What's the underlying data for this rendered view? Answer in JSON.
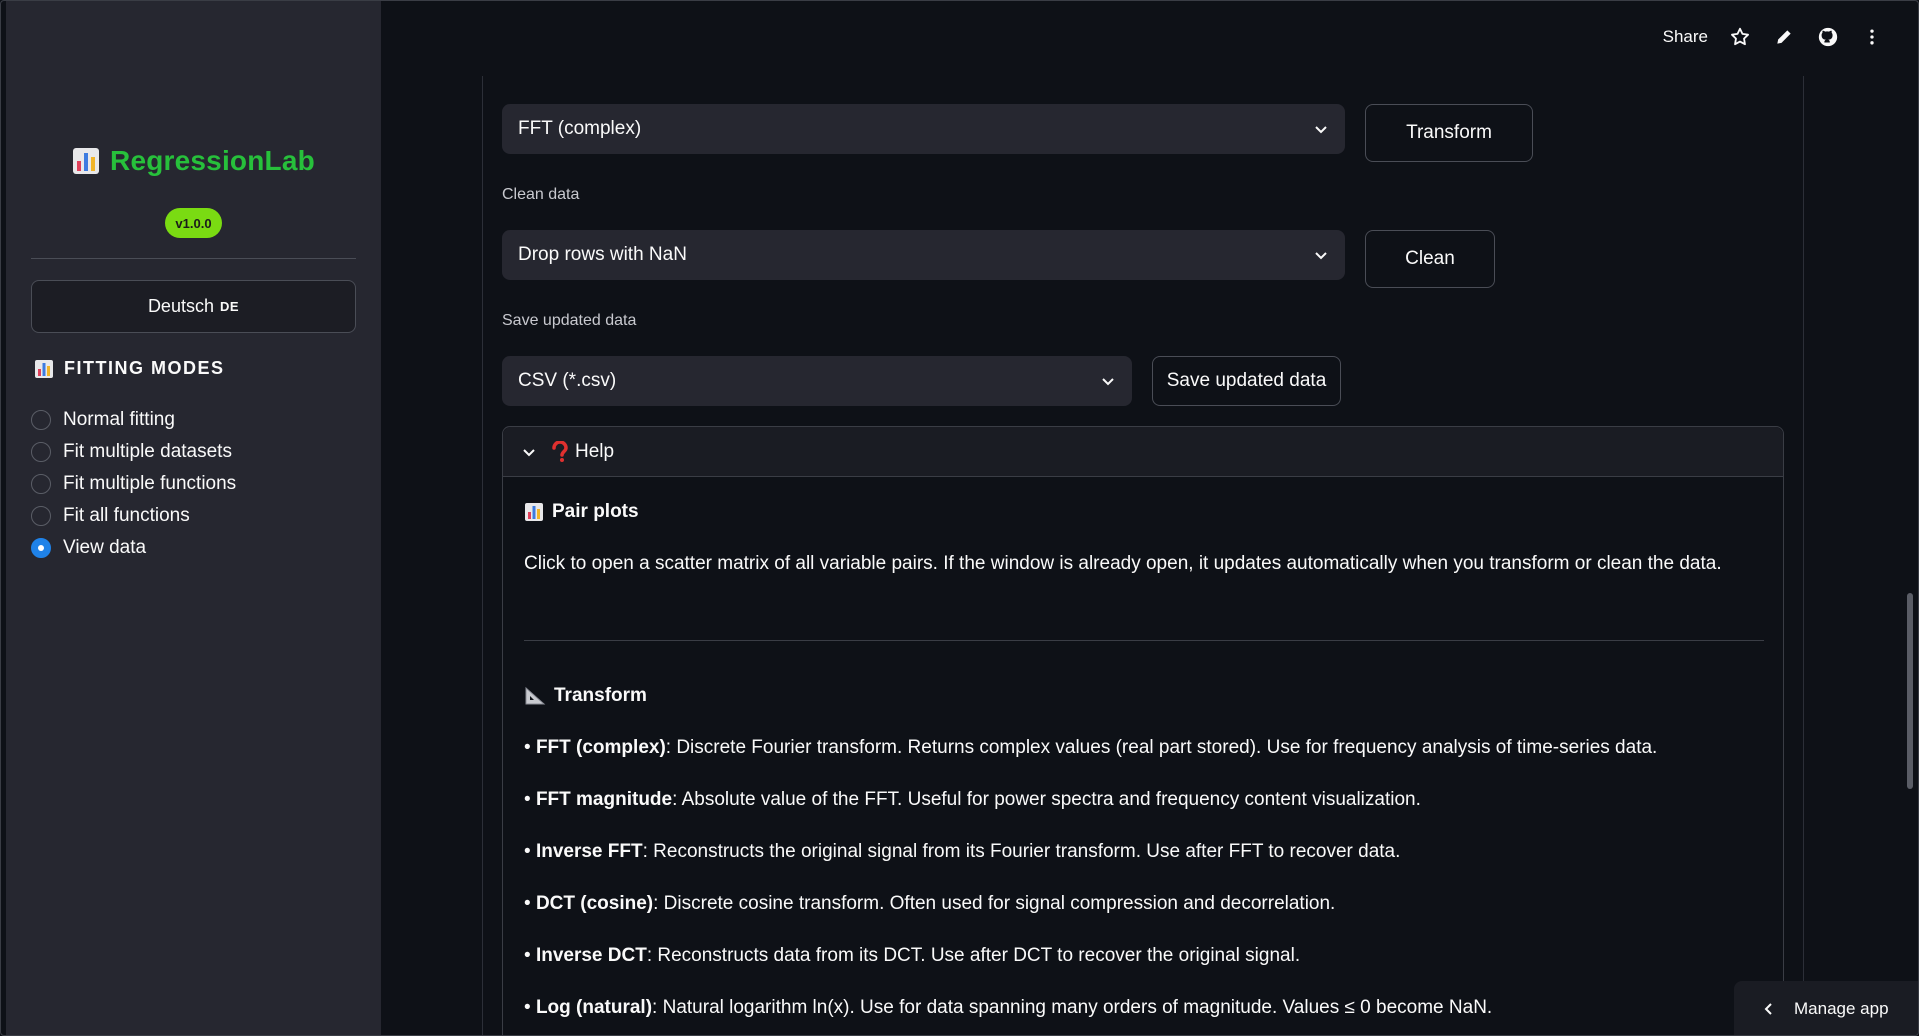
{
  "toolbar": {
    "share_label": "Share",
    "icons": [
      "star-icon",
      "pencil-icon",
      "github-icon",
      "more-vertical-icon"
    ]
  },
  "sidebar": {
    "brand_title": "RegressionLab",
    "version": "v1.0.0",
    "language_button": {
      "label": "Deutsch",
      "code": "DE"
    },
    "modes_title": "FITTING MODES",
    "modes": [
      {
        "label": "Normal fitting",
        "selected": false
      },
      {
        "label": "Fit multiple datasets",
        "selected": false
      },
      {
        "label": "Fit multiple functions",
        "selected": false
      },
      {
        "label": "Fit all functions",
        "selected": false
      },
      {
        "label": "View data",
        "selected": true
      }
    ]
  },
  "main": {
    "transform_select": {
      "value": "FFT (complex)"
    },
    "transform_button": "Transform",
    "clean_label": "Clean data",
    "clean_select": {
      "value": "Drop rows with NaN"
    },
    "clean_button": "Clean",
    "save_label": "Save updated data",
    "save_select": {
      "value": "CSV (*.csv)"
    },
    "save_button": "Save updated data",
    "help": {
      "title": "Help",
      "pair_plots_title": "Pair plots",
      "pair_plots_text": "Click to open a scatter matrix of all variable pairs. If the window is already open, it updates automatically when you transform or clean the data.",
      "transform_title": "Transform",
      "items": [
        {
          "term": "FFT (complex)",
          "desc": ": Discrete Fourier transform. Returns complex values (real part stored). Use for frequency analysis of time-series data."
        },
        {
          "term": "FFT magnitude",
          "desc": ": Absolute value of the FFT. Useful for power spectra and frequency content visualization."
        },
        {
          "term": "Inverse FFT",
          "desc": ": Reconstructs the original signal from its Fourier transform. Use after FFT to recover data."
        },
        {
          "term": "DCT (cosine)",
          "desc": ": Discrete cosine transform. Often used for signal compression and decorrelation."
        },
        {
          "term": "Inverse DCT",
          "desc": ": Reconstructs data from its DCT. Use after DCT to recover the original signal."
        },
        {
          "term": "Log (natural)",
          "desc": ": Natural logarithm ln(x). Use for data spanning many orders of magnitude. Values ≤ 0 become NaN."
        }
      ]
    }
  },
  "manage_app_label": "Manage app",
  "colors": {
    "brand_green": "#27c03b",
    "badge_green": "#7adb12",
    "radio_selected": "#1f82e8",
    "background": "#0e1117",
    "sidebar": "#262730"
  }
}
